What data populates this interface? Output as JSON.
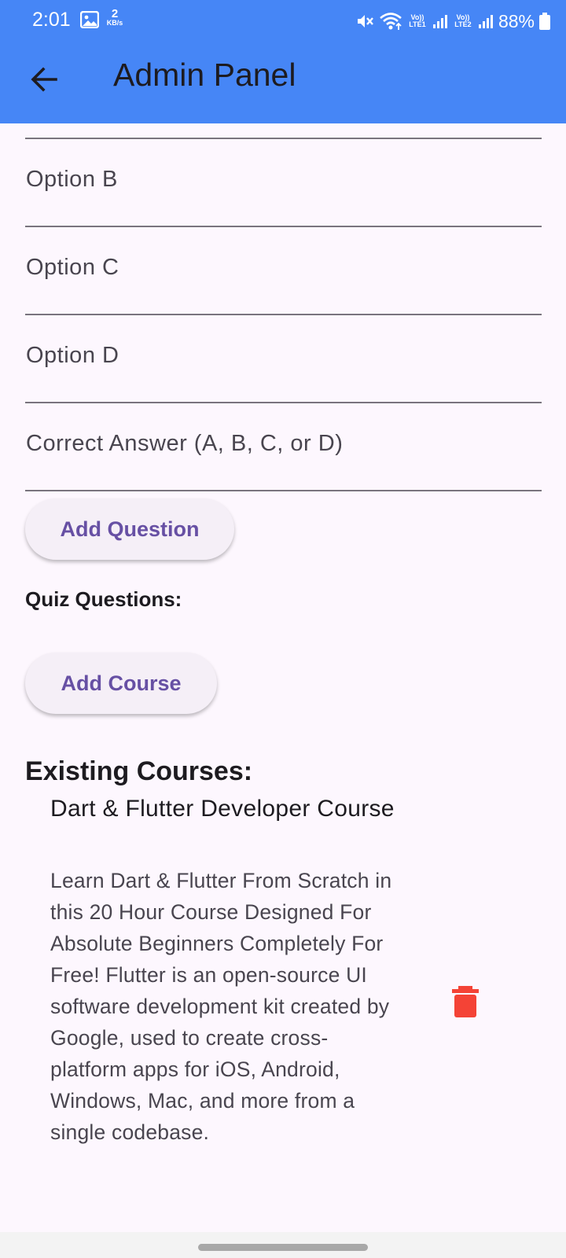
{
  "status_bar": {
    "time": "2:01",
    "net_speed_value": "2",
    "net_speed_unit": "KB/s",
    "sim1_label": "Vo)) LTE1",
    "sim2_label": "Vo)) LTE2",
    "battery_percent": "88%"
  },
  "app_bar": {
    "title": "Admin Panel",
    "color": "#4686f6"
  },
  "form": {
    "option_b_label": "Option B",
    "option_c_label": "Option C",
    "option_d_label": "Option D",
    "correct_answer_label": "Correct Answer (A, B, C, or D)",
    "add_question_label": "Add Question",
    "quiz_questions_heading": "Quiz Questions:",
    "add_course_label": "Add Course"
  },
  "courses": {
    "heading": "Existing Courses:",
    "items": [
      {
        "title": "Dart & Flutter Developer Course",
        "description": "Learn Dart & Flutter From Scratch in this 20 Hour Course Designed For Absolute Beginners Completely For Free! Flutter is an open-source UI software development kit created by Google, used to create cross-platform apps for iOS, Android, Windows, Mac, and more from a single codebase.",
        "delete_icon": "trash-icon",
        "delete_color": "#f44336"
      }
    ]
  },
  "colors": {
    "accent": "#6750a4",
    "background": "#fdf7fe"
  }
}
